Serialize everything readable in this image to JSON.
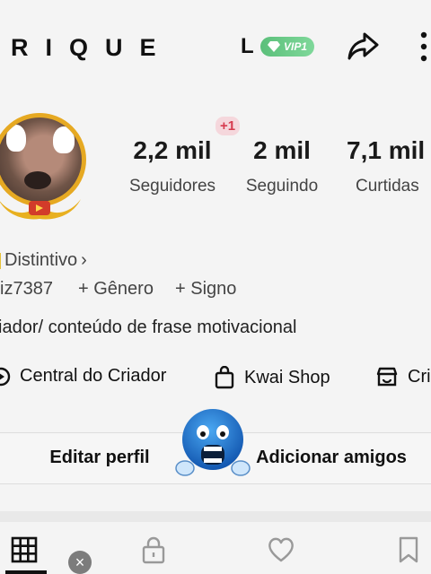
{
  "header": {
    "username": "RIQUE",
    "level_letter": "L",
    "vip_label": "VIP1",
    "icons": [
      "share-icon",
      "more-vertical-icon"
    ]
  },
  "profile": {
    "new_followers_badge": "+1",
    "stats": [
      {
        "value": "2,2 mil",
        "label": "Seguidores"
      },
      {
        "value": "2 mil",
        "label": "Seguindo"
      },
      {
        "value": "7,1 mil",
        "label": "Curtidas"
      }
    ],
    "badge_link": "Distintivo",
    "badge_chevron": "›",
    "user_id": "iz7387",
    "add_gender": "+ Gênero",
    "add_sign": "+ Signo",
    "bio": "iador/ conteúdo de frase motivacional"
  },
  "tools": [
    {
      "label": "Central do Criador",
      "icon": "creator-center-icon"
    },
    {
      "label": "Kwai Shop",
      "icon": "shopping-bag-icon"
    },
    {
      "label": "Cri",
      "icon": "store-icon"
    }
  ],
  "actions": {
    "edit_profile": "Editar perfil",
    "add_friends": "Adicionar amigos"
  },
  "tabs": [
    {
      "icon": "grid-icon",
      "selected": true
    },
    {
      "icon": "lock-icon",
      "selected": false
    },
    {
      "icon": "heart-icon",
      "selected": false
    },
    {
      "icon": "bookmark-icon",
      "selected": false
    }
  ],
  "overlay": {
    "close_glyph": "×"
  },
  "colors": {
    "background": "#f4f4f4",
    "vip_green": "#5bbf7a",
    "badge_red": "#d63a4e",
    "avatar_ring": "#e6a922"
  }
}
